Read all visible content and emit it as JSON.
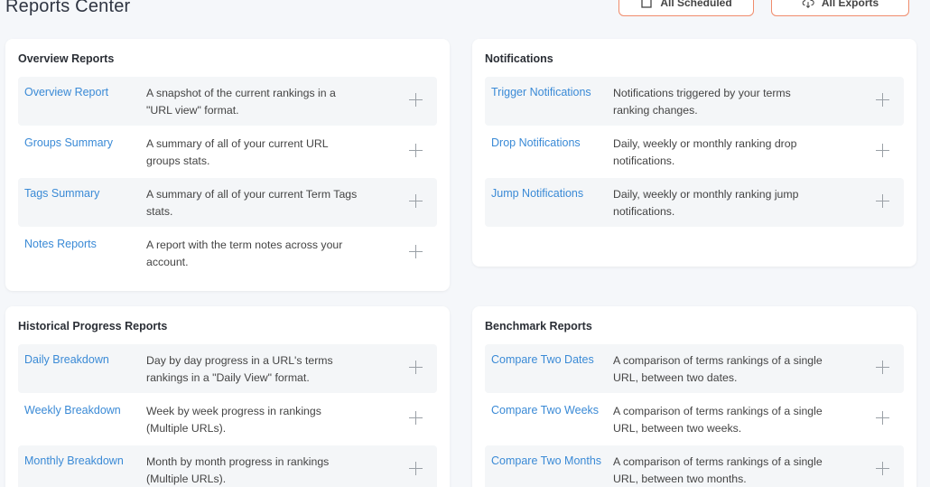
{
  "header": {
    "title": "Reports Center",
    "scheduled_label": "All Scheduled",
    "exports_label": "All Exports"
  },
  "overview": {
    "title": "Overview Reports",
    "items": [
      {
        "label": "Overview Report",
        "desc": "A snapshot of the current rankings in a \"URL view\" format."
      },
      {
        "label": "Groups Summary",
        "desc": "A summary of all of your current URL groups stats."
      },
      {
        "label": "Tags Summary",
        "desc": "A summary of all of your current Term Tags stats."
      },
      {
        "label": "Notes Reports",
        "desc": "A report with the term notes across your account."
      }
    ]
  },
  "notifications": {
    "title": "Notifications",
    "items": [
      {
        "label": "Trigger Notifications",
        "desc": "Notifications triggered by your terms ranking changes."
      },
      {
        "label": "Drop Notifications",
        "desc": "Daily, weekly or monthly ranking drop notifications."
      },
      {
        "label": "Jump Notifications",
        "desc": "Daily, weekly or monthly ranking jump notifications."
      }
    ]
  },
  "historical": {
    "title": "Historical Progress Reports",
    "items": [
      {
        "label": "Daily Breakdown",
        "desc": "Day by day progress in a URL's terms rankings in a \"Daily View\" format."
      },
      {
        "label": "Weekly Breakdown",
        "desc": "Week by week progress in rankings (Multiple URLs)."
      },
      {
        "label": "Monthly Breakdown",
        "desc": "Month by month progress in rankings (Multiple URLs)."
      }
    ]
  },
  "benchmark": {
    "title": "Benchmark Reports",
    "items": [
      {
        "label": "Compare Two Dates",
        "desc": "A comparison of terms rankings of a single URL, between two dates."
      },
      {
        "label": "Compare Two Weeks",
        "desc": "A comparison of terms rankings of a single URL, between two weeks."
      },
      {
        "label": "Compare Two Months",
        "desc": "A comparison of terms rankings of a single URL, between two months."
      }
    ]
  },
  "colors": {
    "accent_link": "#3a8ad6",
    "button_border": "#f08c6c",
    "row_bg": "#f4f6f8"
  },
  "icons": {
    "scheduled": "square-icon",
    "exports": "cloud-download-icon",
    "row_action": "plus-icon"
  }
}
